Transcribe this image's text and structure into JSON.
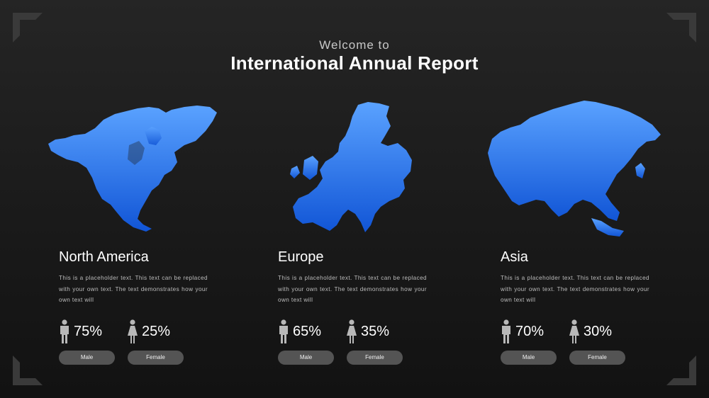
{
  "header": {
    "subtitle": "Welcome to",
    "title": "International Annual Report"
  },
  "colors": {
    "map_top": "#5aa2ff",
    "map_bottom": "#1155d6",
    "pill": "#545454",
    "icon": "#b8b8b8"
  },
  "regions": [
    {
      "name": "North America",
      "description": "This is a placeholder text. This text can be replaced with your own text. The text demonstrates how your own text will",
      "male_pct": "75%",
      "female_pct": "25%",
      "male_label": "Male",
      "female_label": "Female"
    },
    {
      "name": "Europe",
      "description": "This is a placeholder text. This text can be replaced with your own text. The text demonstrates how your own text will",
      "male_pct": "65%",
      "female_pct": "35%",
      "male_label": "Male",
      "female_label": "Female"
    },
    {
      "name": "Asia",
      "description": "This is a placeholder text. This text can be replaced with your own text. The text demonstrates how your own text will",
      "male_pct": "70%",
      "female_pct": "30%",
      "male_label": "Male",
      "female_label": "Female"
    }
  ]
}
